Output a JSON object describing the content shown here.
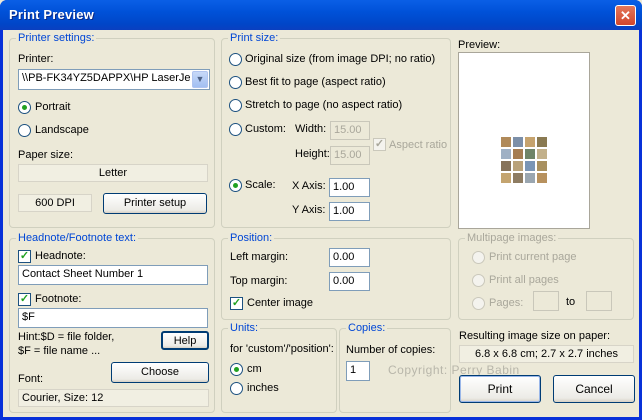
{
  "window": {
    "title": "Print Preview",
    "close_glyph": "✕"
  },
  "printer_settings": {
    "legend": "Printer settings:",
    "printer_label": "Printer:",
    "printer_value": "\\\\PB-FK34YZ5DAPPX\\HP LaserJe",
    "portrait": "Portrait",
    "landscape": "Landscape",
    "orientation_selected": "Portrait",
    "paper_size_label": "Paper size:",
    "paper_size_value": "Letter",
    "dpi_value": "600 DPI",
    "printer_setup_button": "Printer setup"
  },
  "print_size": {
    "legend": "Print size:",
    "original": "Original size (from image DPI; no ratio)",
    "best_fit": "Best fit to page (aspect ratio)",
    "stretch": "Stretch to page (no aspect ratio)",
    "custom": "Custom:",
    "width_label": "Width:",
    "width_value": "15.00",
    "height_label": "Height:",
    "height_value": "15.00",
    "aspect_ratio": "Aspect ratio",
    "aspect_ratio_checked": true,
    "scale": "Scale:",
    "x_axis_label": "X Axis:",
    "x_axis_value": "1.00",
    "y_axis_label": "Y Axis:",
    "y_axis_value": "1.00",
    "selected": "Scale"
  },
  "preview": {
    "label": "Preview:",
    "thumb_colors": [
      "#b08a5a",
      "#7c8fa8",
      "#c6a36e",
      "#8a7a52",
      "#9fb0c4",
      "#a57d52",
      "#6f8468",
      "#c2b08a",
      "#87735a",
      "#b9a27a",
      "#7a95b5",
      "#a8905f",
      "#c4a46f",
      "#8e7c62",
      "#9aa6b0",
      "#b7915e"
    ]
  },
  "headnote": {
    "legend": "Headnote/Footnote text:",
    "headnote_label": "Headnote:",
    "headnote_checked": true,
    "headnote_value": "Contact Sheet Number 1",
    "footnote_label": "Footnote:",
    "footnote_checked": true,
    "footnote_value": "$F",
    "hint_line1": "Hint:$D = file folder,",
    "hint_line2": "$F = file name ...",
    "help_button": "Help",
    "font_label": "Font:",
    "choose_button": "Choose",
    "font_value": "Courier, Size: 12"
  },
  "position": {
    "legend": "Position:",
    "left_margin_label": "Left margin:",
    "left_margin_value": "0.00",
    "top_margin_label": "Top margin:",
    "top_margin_value": "0.00",
    "center_image": "Center image",
    "center_image_checked": true
  },
  "multipage": {
    "legend": "Multipage images:",
    "print_current": "Print current page",
    "print_all": "Print all pages",
    "pages": "Pages:",
    "to": "to"
  },
  "units": {
    "legend": "Units:",
    "caption": "for 'custom'/'position':",
    "cm": "cm",
    "inches": "inches",
    "selected": "cm"
  },
  "copies": {
    "legend": "Copies:",
    "label": "Number of copies:",
    "value": "1"
  },
  "copyright": "Copyright: Perry Babin",
  "result": {
    "label": "Resulting image size on paper:",
    "value": "6.8 x 6.8 cm; 2.7 x 2.7 inches"
  },
  "buttons": {
    "print": "Print",
    "cancel": "Cancel"
  }
}
